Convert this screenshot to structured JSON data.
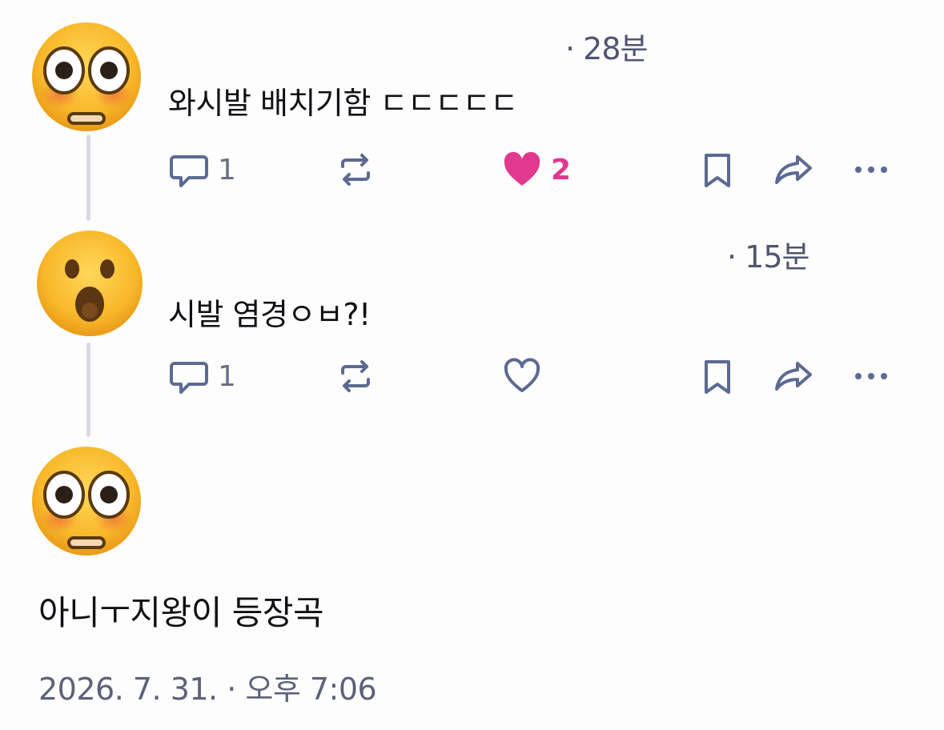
{
  "posts": [
    {
      "avatar": "flushed-face-icon",
      "time": "· 28분",
      "text": "와시발 배치기함 ㄷㄷㄷㄷㄷ",
      "replies": "1",
      "likes": "2",
      "liked": true
    },
    {
      "avatar": "hushed-face-icon",
      "time": "· 15분",
      "text": "시발 염경ㅇㅂ?!",
      "replies": "1",
      "likes": "",
      "liked": false
    }
  ],
  "main_post": {
    "avatar": "flushed-face-icon",
    "text": "아니ㅜ지왕이 등장곡",
    "date": "2026. 7. 31. · 오후 7:06"
  },
  "colors": {
    "like_active": "#e0398f",
    "icon": "#5c6a93",
    "thread_line": "#d9dbe3"
  }
}
